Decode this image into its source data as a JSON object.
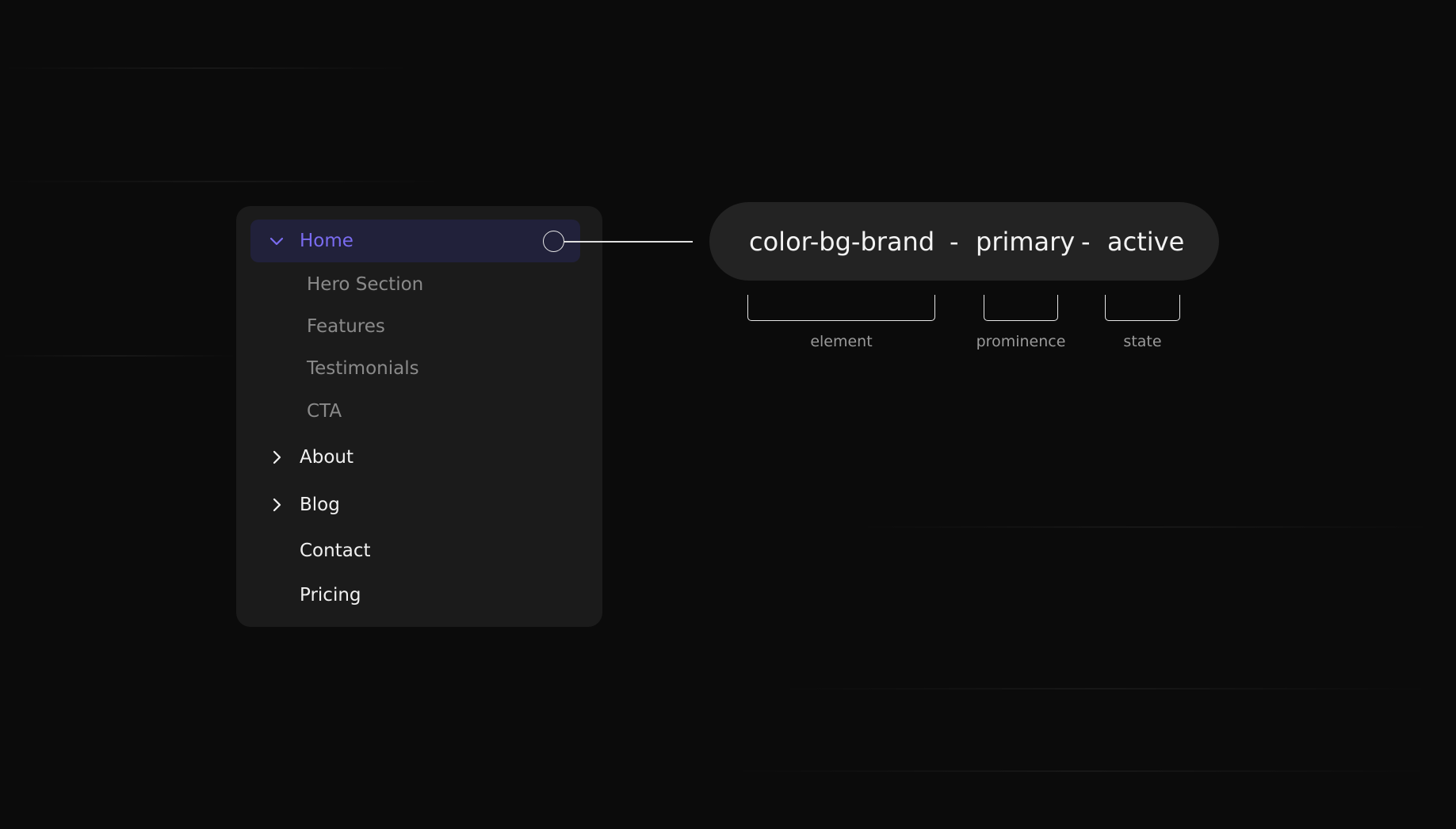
{
  "nav": {
    "home": "Home",
    "sub_items": [
      "Hero Section",
      "Features",
      "Testimonials",
      "CTA"
    ],
    "about": "About",
    "blog": "Blog",
    "contact": "Contact",
    "pricing": "Pricing"
  },
  "token": {
    "element": "color-bg-brand",
    "sep1": "-",
    "prominence": "primary",
    "sep2": "-",
    "state": "active"
  },
  "brackets": {
    "element_label": "element",
    "prominence_label": "prominence",
    "state_label": "state"
  },
  "colors": {
    "background": "#0b0b0b",
    "panel": "#1b1b1b",
    "active_row": "#21213a",
    "accent": "#7a6cf0",
    "pill": "#232323"
  }
}
